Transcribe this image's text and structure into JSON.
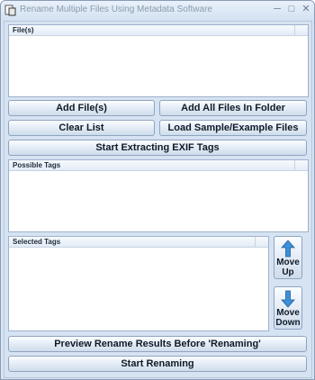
{
  "window": {
    "title": "Rename Multiple Files Using Metadata Software",
    "minimize_glyph": "─",
    "maximize_glyph": "□",
    "close_glyph": "✕"
  },
  "files_panel": {
    "header": "File(s)"
  },
  "buttons": {
    "add_files": "Add File(s)",
    "add_all_in_folder": "Add All Files In Folder",
    "clear_list": "Clear List",
    "load_sample": "Load Sample/Example Files",
    "start_extracting": "Start Extracting EXIF Tags",
    "preview": "Preview Rename Results Before 'Renaming'",
    "start_renaming": "Start Renaming"
  },
  "possible_tags_panel": {
    "header": "Possible Tags"
  },
  "selected_tags_panel": {
    "header": "Selected Tags"
  },
  "move_up": {
    "line1": "Move",
    "line2": "Up",
    "icon": "arrow-up-icon"
  },
  "move_down": {
    "line1": "Move",
    "line2": "Down",
    "icon": "arrow-down-icon"
  },
  "colors": {
    "arrow_blue": "#3d8fd6",
    "window_bg": "#d6e3f2"
  }
}
